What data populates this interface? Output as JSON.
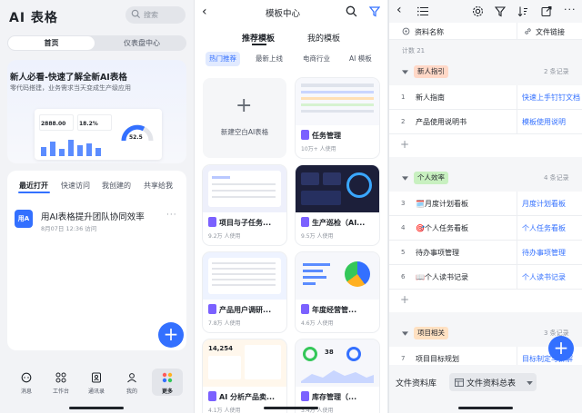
{
  "colors": {
    "accent": "#3370ff",
    "group1": "#ffd8c7",
    "group2": "#c8f0c0",
    "group3": "#ffe1c2"
  },
  "p1": {
    "title": "AI 表格",
    "search_placeholder": "搜索",
    "tabs": [
      "首页",
      "仪表盘中心"
    ],
    "banner": {
      "title": "新人必看-快速了解全新AI表格",
      "subtitle": "零代码搭建，业务需求当天变成生产级应用",
      "kpis": [
        "2888.00",
        "18.2%",
        "52.5"
      ]
    },
    "recent_tabs": [
      "最近打开",
      "快速访问",
      "我创建的",
      "共享给我"
    ],
    "doc": {
      "icon": "用A",
      "title": "用AI表格提升团队协同效率",
      "meta": "8月07日 12:36 访问"
    },
    "tabbar": [
      "消息",
      "工作台",
      "通讯录",
      "我的",
      "更多"
    ]
  },
  "p2": {
    "title": "模板中心",
    "top_tabs": [
      "推荐模板",
      "我的模板"
    ],
    "chips": [
      "热门推荐",
      "最新上线",
      "电商行业",
      "AI 模板"
    ],
    "blank_label": "新建空白AI表格",
    "cards": [
      {
        "title": "任务管理",
        "uses": "10万+ 人使用"
      },
      {
        "title": "项目与子任务...",
        "uses": "9.2万 人使用"
      },
      {
        "title": "生产巡检（AI...",
        "uses": "9.5万 人使用"
      },
      {
        "title": "产品用户调研...",
        "uses": "7.8万 人使用"
      },
      {
        "title": "年度经营管...",
        "uses": "4.6万 人使用"
      },
      {
        "title": "AI 分析产品卖...",
        "uses": "4.1万 人使用"
      },
      {
        "title": "库存管理（...",
        "uses": "3.4万 人使用"
      }
    ],
    "card_thumb_labels": {
      "dash_metric": "14,254",
      "dash_metric2": "38"
    }
  },
  "p3": {
    "col_name": "资料名称",
    "col_link": "文件链接",
    "count": "计数 21",
    "groups": [
      {
        "label": "新人指引",
        "count": "2 条记录",
        "rows": [
          {
            "idx": "1",
            "name": "新人指南",
            "link": "快速上手钉钉文档"
          },
          {
            "idx": "2",
            "name": "产品使用说明书",
            "link": "模板使用说明"
          }
        ]
      },
      {
        "label": "个人效率",
        "count": "4 条记录",
        "rows": [
          {
            "idx": "3",
            "name": "🗓️月度计划看板",
            "link": "月度计划看板"
          },
          {
            "idx": "4",
            "name": "🎯个人任务看板",
            "link": "个人任务看板"
          },
          {
            "idx": "5",
            "name": "待办事项管理",
            "link": "待办事项管理"
          },
          {
            "idx": "6",
            "name": "📖个人读书记录",
            "link": "个人读书记录"
          }
        ]
      },
      {
        "label": "项目相关",
        "count": "3 条记录",
        "rows": [
          {
            "idx": "7",
            "name": "项目目标规划",
            "link": "目标制定与拆解"
          }
        ]
      }
    ],
    "footer": {
      "library": "文件资料库",
      "sheet": "文件资料总表"
    }
  }
}
